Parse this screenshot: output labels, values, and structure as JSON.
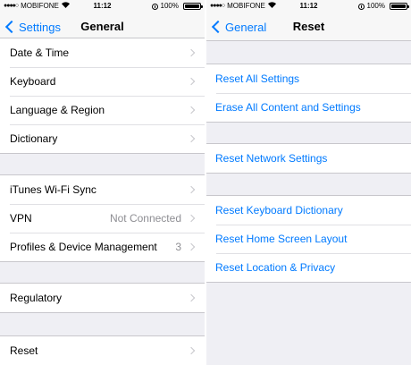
{
  "status_bar": {
    "signal_dots": "●●●●○",
    "carrier": "MOBIFONE",
    "wifi_icon": "wifi-icon",
    "time": "11:12",
    "battery": "100%"
  },
  "left": {
    "nav": {
      "back_label": "Settings",
      "title": "General"
    },
    "rows": [
      {
        "label": "Date & Time"
      },
      {
        "label": "Keyboard"
      },
      {
        "label": "Language & Region"
      },
      {
        "label": "Dictionary"
      },
      {
        "label": "iTunes Wi-Fi Sync"
      },
      {
        "label": "VPN",
        "value": "Not Connected"
      },
      {
        "label": "Profiles & Device Management",
        "value": "3"
      },
      {
        "label": "Regulatory"
      },
      {
        "label": "Reset"
      }
    ]
  },
  "right": {
    "nav": {
      "back_label": "General",
      "title": "Reset"
    },
    "rows": [
      {
        "label": "Reset All Settings"
      },
      {
        "label": "Erase All Content and Settings"
      },
      {
        "label": "Reset Network Settings"
      },
      {
        "label": "Reset Keyboard Dictionary"
      },
      {
        "label": "Reset Home Screen Layout"
      },
      {
        "label": "Reset Location & Privacy"
      }
    ]
  },
  "colors": {
    "accent": "#007aff",
    "background": "#efeff4",
    "separator": "#c8c7cc",
    "secondary_text": "#8e8e93"
  }
}
